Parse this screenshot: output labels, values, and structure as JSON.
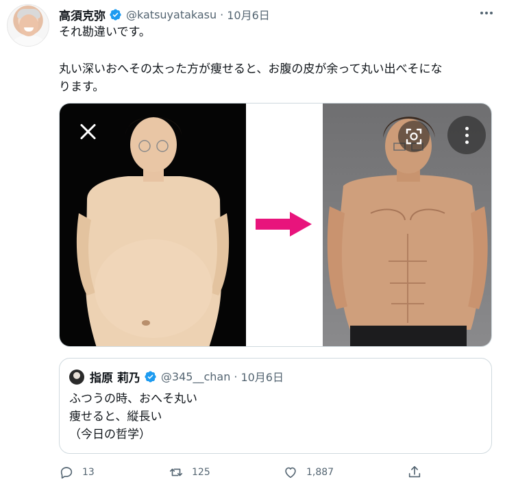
{
  "tweet": {
    "name": "高須克弥",
    "handle": "@katsuyatakasu",
    "separator": "·",
    "date": "10月6日",
    "text_line1": "それ勘違いです。",
    "text_line2": "丸い深いおへその太った方が痩せると、お腹の皮が余って丸い出べそにな",
    "text_line3": "ります。"
  },
  "quote": {
    "name": "指原 莉乃",
    "handle": "@345__chan",
    "separator": "·",
    "date": "10月6日",
    "lines": [
      "ふつうの時、おへそ丸い",
      "痩せると、縦長い",
      "（今日の哲学）"
    ]
  },
  "actions": {
    "replies": "13",
    "retweets": "125",
    "likes": "1,887"
  },
  "colors": {
    "verified": "#1d9bf0",
    "secondary_text": "#536471",
    "arrow": "#e8147c",
    "border": "#cfd9de"
  },
  "icons": [
    "verified-badge-icon",
    "more-icon",
    "close-icon",
    "lens-icon",
    "image-more-icon",
    "reply-icon",
    "retweet-icon",
    "like-icon",
    "share-icon"
  ]
}
